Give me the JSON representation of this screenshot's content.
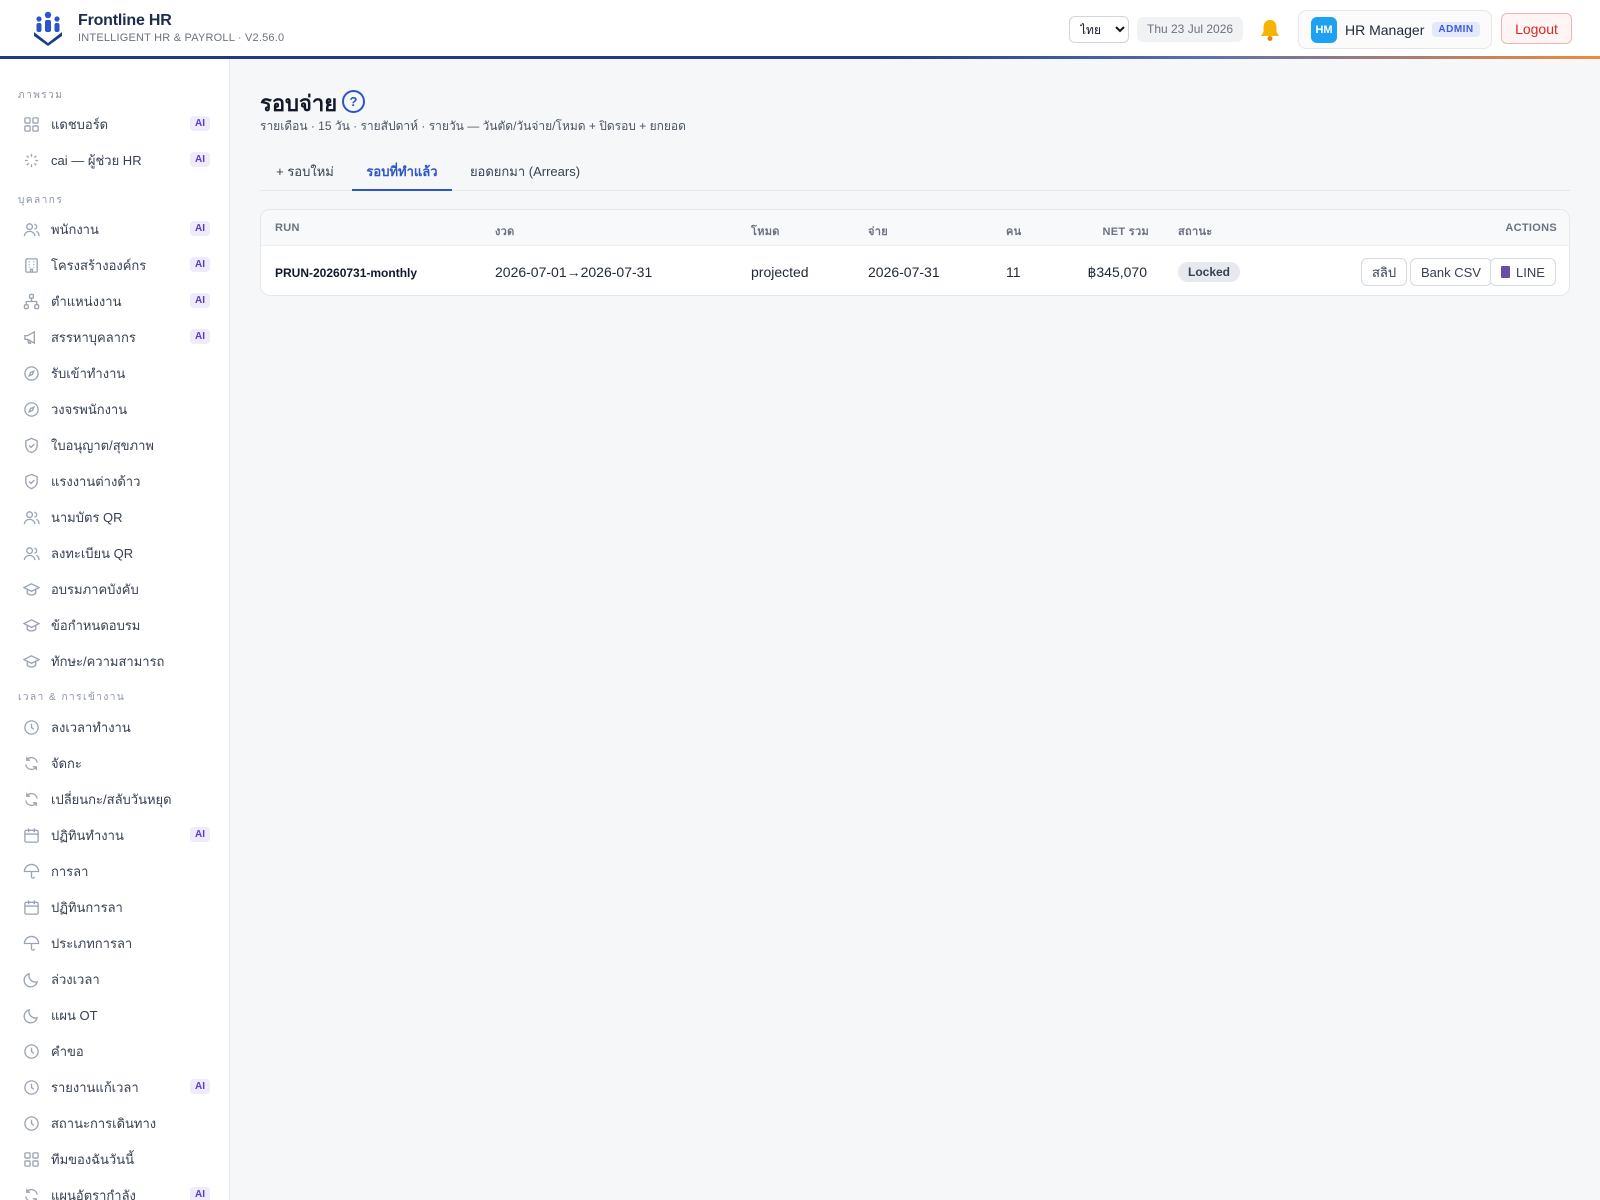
{
  "header": {
    "app_name": "Frontline HR",
    "app_subtitle": "INTELLIGENT HR & PAYROLL · V2.56.0",
    "language": "ไทย",
    "date": "Thu 23 Jul 2026",
    "user_initials": "HM",
    "user_name": "HR Manager",
    "user_role": "ADMIN",
    "logout_label": "Logout",
    "accent_color": "#1e3a8a"
  },
  "sidebar": {
    "sections": [
      {
        "title": "ภาพรวม"
      },
      {
        "title": "บุคลากร"
      },
      {
        "title": "เวลา & การเข้างาน"
      }
    ],
    "items": [
      {
        "label": "แดชบอร์ด",
        "icon": "grid-icon",
        "ai": "AI"
      },
      {
        "label": "cai — ผู้ช่วย HR",
        "icon": "sparkle-icon",
        "ai": "AI"
      },
      {
        "label": "พนักงาน",
        "icon": "users-icon",
        "ai": "AI"
      },
      {
        "label": "โครงสร้างองค์กร",
        "icon": "building-icon",
        "ai": "AI"
      },
      {
        "label": "ตำแหน่งงาน",
        "icon": "hierarchy-icon",
        "ai": "AI"
      },
      {
        "label": "สรรหาบุคลากร",
        "icon": "megaphone-icon",
        "ai": "AI"
      },
      {
        "label": "รับเข้าทำงาน",
        "icon": "compass-icon"
      },
      {
        "label": "วงจรพนักงาน",
        "icon": "compass-icon"
      },
      {
        "label": "ใบอนุญาต/สุขภาพ",
        "icon": "shield-icon"
      },
      {
        "label": "แรงงานต่างด้าว",
        "icon": "shield-icon"
      },
      {
        "label": "นามบัตร QR",
        "icon": "users-icon"
      },
      {
        "label": "ลงทะเบียน QR",
        "icon": "users-icon"
      },
      {
        "label": "อบรมภาคบังคับ",
        "icon": "graduation-cap-icon"
      },
      {
        "label": "ข้อกำหนดอบรม",
        "icon": "graduation-cap-icon"
      },
      {
        "label": "ทักษะ/ความสามารถ",
        "icon": "graduation-cap-icon"
      },
      {
        "label": "ลงเวลาทำงาน",
        "icon": "clock-icon"
      },
      {
        "label": "จัดกะ",
        "icon": "refresh-icon"
      },
      {
        "label": "เปลี่ยนกะ/สลับวันหยุด",
        "icon": "refresh-icon"
      },
      {
        "label": "ปฏิทินทำงาน",
        "icon": "calendar-icon",
        "ai": "AI"
      },
      {
        "label": "การลา",
        "icon": "umbrella-icon"
      },
      {
        "label": "ปฏิทินการลา",
        "icon": "calendar-icon"
      },
      {
        "label": "ประเภทการลา",
        "icon": "umbrella-icon"
      },
      {
        "label": "ล่วงเวลา",
        "icon": "moon-icon"
      },
      {
        "label": "แผน OT",
        "icon": "moon-icon"
      },
      {
        "label": "คำขอ",
        "icon": "clock-icon"
      },
      {
        "label": "รายงานแก้เวลา",
        "icon": "clock-icon",
        "ai": "AI"
      },
      {
        "label": "สถานะการเดินทาง",
        "icon": "clock-icon"
      },
      {
        "label": "ทีมของฉันวันนี้",
        "icon": "grid-icon"
      },
      {
        "label": "แผนอัตรากำลัง",
        "icon": "refresh-icon",
        "ai": "AI"
      }
    ]
  },
  "main": {
    "title": "รอบจ่าย",
    "help": "?",
    "subtitle": "รายเดือน · 15 วัน · รายสัปดาห์ · รายวัน — วันตัด/วันจ่าย/โหมด + ปิดรอบ + ยกยอด",
    "tabs": [
      {
        "label": "+ รอบใหม่"
      },
      {
        "label": "รอบที่ทำแล้ว"
      },
      {
        "label": "ยอดยกมา (Arrears)"
      }
    ],
    "active_tab": "รอบที่ทำแล้ว",
    "table": {
      "columns": [
        "RUN",
        "งวด",
        "โหมด",
        "จ่าย",
        "คน",
        "NET รวม",
        "สถานะ",
        "ACTIONS"
      ],
      "rows": [
        {
          "run": "PRUN-20260731-monthly",
          "period": "2026-07-01→2026-07-31",
          "mode": "projected",
          "pay_date": "2026-07-31",
          "headcount": "11",
          "net_total": "฿345,070",
          "status": "Locked",
          "actions": [
            "สลิป",
            "Bank CSV",
            "LINE"
          ]
        }
      ]
    }
  }
}
